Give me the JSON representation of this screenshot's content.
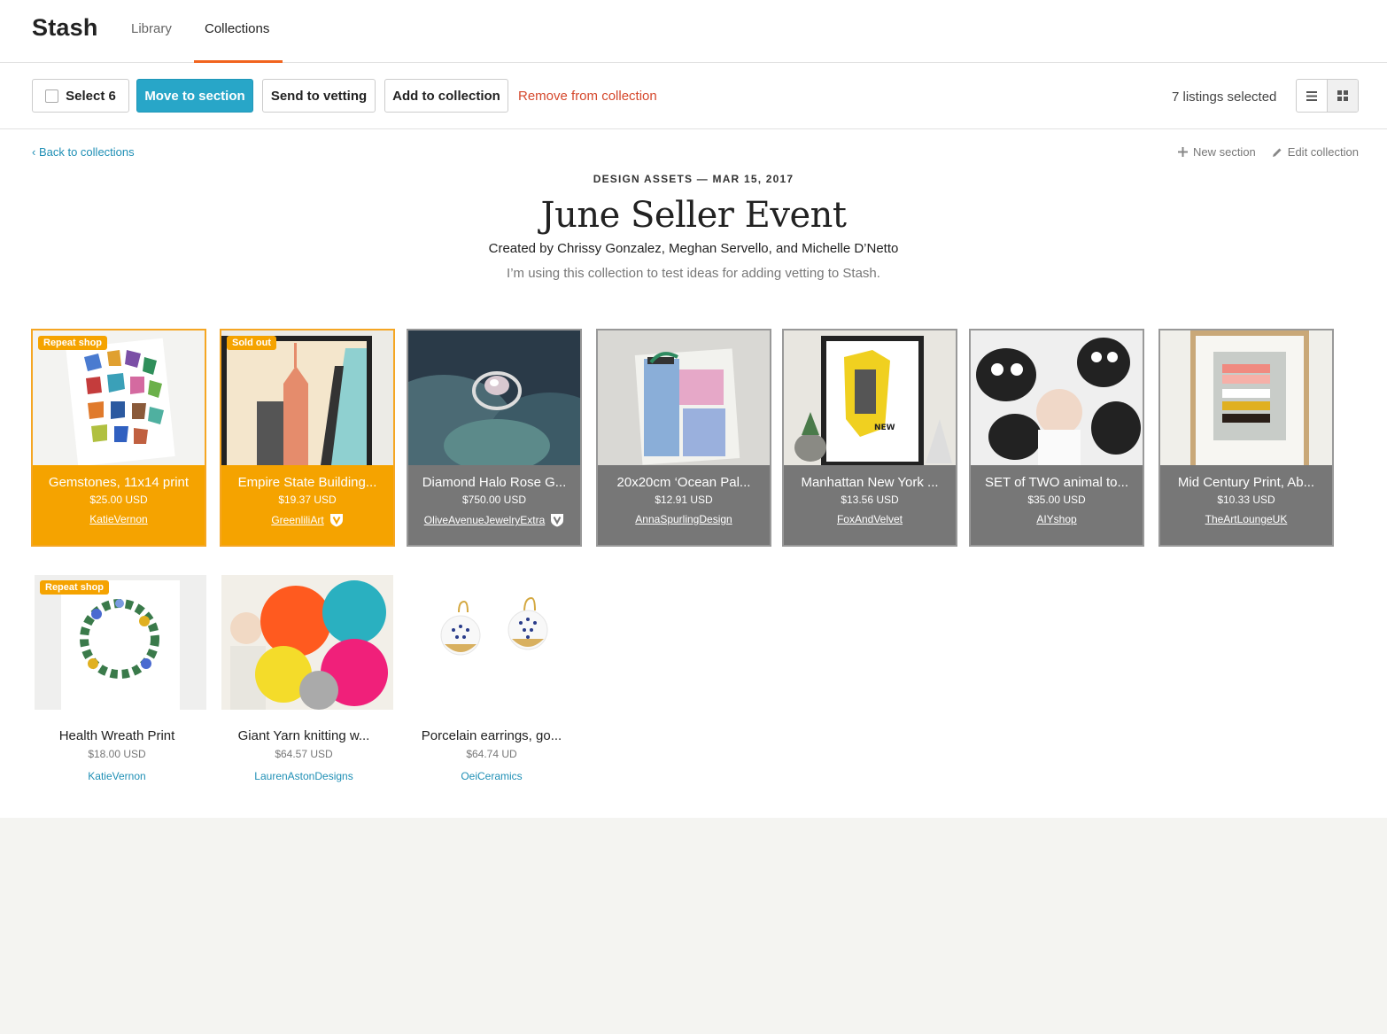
{
  "nav": {
    "brand": "Stash",
    "tabs": [
      {
        "label": "Library"
      },
      {
        "label": "Collections"
      }
    ]
  },
  "toolbar": {
    "select_label": "Select 6",
    "move_label": "Move to section",
    "vetting_label": "Send to vetting",
    "add_label": "Add to collection",
    "remove_label": "Remove from collection",
    "selected_count": "7 listings selected"
  },
  "header": {
    "back_label": "Back to collections",
    "new_section_label": "New section",
    "edit_collection_label": "Edit collection",
    "eyebrow": "DESIGN ASSETS — MAR 15, 2017",
    "title": "June Seller Event",
    "byline": "Created by Chrissy Gonzalez, Meghan Servello, and Michelle D’Netto",
    "description": "I’m using this collection to test ideas for adding vetting to Stash."
  },
  "colors": {
    "accent_orange": "#f5a300",
    "primary_blue": "#28a6c8",
    "remove_red": "#d5482c",
    "link_blue": "#1f8fb5"
  },
  "listings": [
    {
      "name": "Gemstones, 11x14 print",
      "price": "$25.00 USD",
      "shop": "KatieVernon",
      "badge": "Repeat shop",
      "vetted": false
    },
    {
      "name": "Empire State Building...",
      "price": "$19.37 USD",
      "shop": "GreenliliArt",
      "badge": "Sold out",
      "vetted": true
    },
    {
      "name": "Diamond Halo Rose G...",
      "price": "$750.00 USD",
      "shop": "OliveAvenueJewelryExtra",
      "badge": "",
      "vetted": true
    },
    {
      "name": "20x20cm ‘Ocean Pal...",
      "price": "$12.91 USD",
      "shop": "AnnaSpurlingDesign",
      "badge": "",
      "vetted": false
    },
    {
      "name": "Manhattan New York ...",
      "price": "$13.56 USD",
      "shop": "FoxAndVelvet",
      "badge": "",
      "vetted": false
    },
    {
      "name": "SET of TWO animal to...",
      "price": "$35.00 USD",
      "shop": "AIYshop",
      "badge": "",
      "vetted": false
    },
    {
      "name": "Mid Century Print, Ab...",
      "price": "$10.33 USD",
      "shop": "TheArtLoungeUK",
      "badge": "",
      "vetted": false
    },
    {
      "name": "Health Wreath Print",
      "price": "$18.00 USD",
      "shop": "KatieVernon",
      "badge": "Repeat shop",
      "vetted": false
    },
    {
      "name": "Giant Yarn knitting w...",
      "price": "$64.57 USD",
      "shop": "LaurenAstonDesigns",
      "badge": "",
      "vetted": false
    },
    {
      "name": "Porcelain earrings, go...",
      "price": "$64.74 UD",
      "shop": "OeiCeramics",
      "badge": "",
      "vetted": false
    }
  ]
}
